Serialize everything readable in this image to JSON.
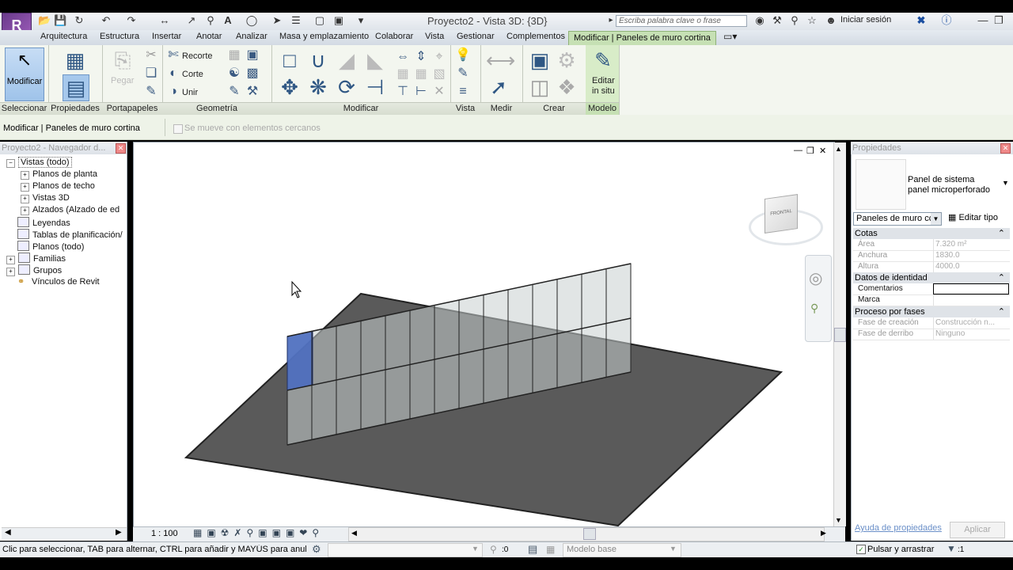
{
  "titlebar": {
    "document_title": "Proyecto2 - Vista 3D: {3D}",
    "search_placeholder": "Escriba palabra clave o frase",
    "signin": "Iniciar sesión"
  },
  "tabs": [
    "Arquitectura",
    "Estructura",
    "Insertar",
    "Anotar",
    "Analizar",
    "Masa y emplazamiento",
    "Colaborar",
    "Vista",
    "Gestionar",
    "Complementos"
  ],
  "active_tab": "Modificar | Paneles de muro cortina",
  "ribbon": {
    "modificar_label": "Modificar",
    "pegar_label": "Pegar",
    "recorte_label": "Recorte",
    "corte_label": "Corte",
    "unir_label": "Unir",
    "editar_label": "Editar",
    "in_situ_label": "in situ",
    "panels": [
      "Seleccionar",
      "Propiedades",
      "Portapapeles",
      "Geometría",
      "Modificar",
      "Vista",
      "Medir",
      "Crear",
      "Modelo"
    ]
  },
  "context": {
    "title": "Modificar | Paneles de muro cortina",
    "checkbox_label": "Se mueve con elementos cercanos"
  },
  "browser": {
    "header": "Proyecto2 - Navegador d...",
    "items": [
      "Vistas (todo)",
      "Planos de planta",
      "Planos de techo",
      "Vistas 3D",
      "Alzados (Alzado de ed",
      "Leyendas",
      "Tablas de planificación/",
      "Planos (todo)",
      "Familias",
      "Grupos",
      "Vínculos de Revit"
    ]
  },
  "viewport": {
    "scale": "1 : 100",
    "viewcube_label": "FRONTAL"
  },
  "properties": {
    "header": "Propiedades",
    "type_line1": "Panel de sistema",
    "type_line2": "panel microperforado",
    "selector": "Paneles de muro cc",
    "edit_type": "Editar tipo",
    "groups": {
      "cotas": "Cotas",
      "identidad": "Datos de identidad",
      "fases": "Proceso por fases"
    },
    "rows": {
      "area_k": "Área",
      "area_v": "7.320 m²",
      "anchura_k": "Anchura",
      "anchura_v": "1830.0",
      "altura_k": "Altura",
      "altura_v": "4000.0",
      "comentarios_k": "Comentarios",
      "marca_k": "Marca",
      "fase_creacion_k": "Fase de creación",
      "fase_creacion_v": "Construcción n...",
      "fase_derribo_k": "Fase de derribo",
      "fase_derribo_v": "Ninguno"
    },
    "help_link": "Ayuda de propiedades",
    "apply_label": "Aplicar"
  },
  "statusbar": {
    "hint": "Clic para seleccionar, TAB para alternar, CTRL para añadir y MAYÚS para anular una s",
    "counter": ":0",
    "model": "Modelo base",
    "drag_label": "Pulsar y arrastrar",
    "filter_count": ":1"
  },
  "colors": {
    "ribbon_active": "#c6e0b4",
    "selected_panel": "#4a6bbf",
    "floor": "#5a5a5a"
  }
}
